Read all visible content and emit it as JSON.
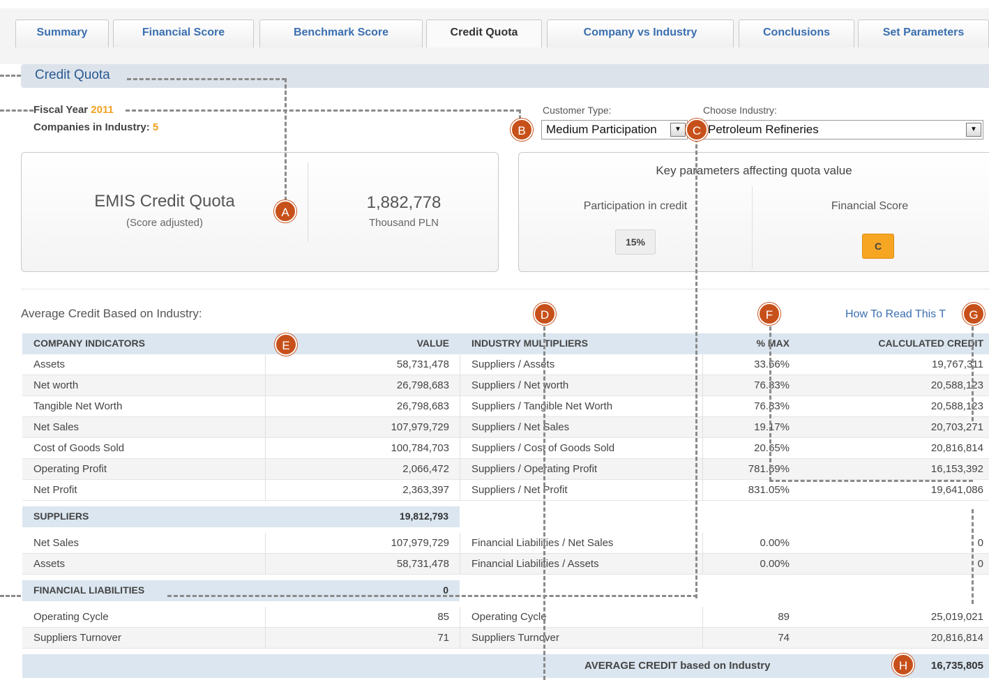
{
  "tabs": [
    {
      "label": "Summary"
    },
    {
      "label": "Financial Score"
    },
    {
      "label": "Benchmark Score"
    },
    {
      "label": "Credit Quota"
    },
    {
      "label": "Company vs Industry"
    },
    {
      "label": "Conclusions"
    },
    {
      "label": "Set Parameters"
    }
  ],
  "active_tab": "Credit Quota",
  "section_title": "Credit Quota",
  "fiscal_year": {
    "label": "Fiscal Year",
    "value": "2011"
  },
  "companies": {
    "label": "Companies in Industry:",
    "value": "5"
  },
  "customer_type": {
    "label": "Customer Type:",
    "value": "Medium Participation"
  },
  "industry": {
    "label": "Choose Industry:",
    "value": "Petroleum Refineries"
  },
  "quota_panel": {
    "title": "EMIS Credit Quota",
    "subtitle": "(Score adjusted)",
    "value": "1,882,778",
    "unit": "Thousand PLN"
  },
  "key_params": {
    "title": "Key parameters affecting quota value",
    "participation_label": "Participation in credit",
    "participation_value": "15%",
    "score_label": "Financial Score",
    "score_value": "C"
  },
  "avg_title": "Average Credit Based on Industry:",
  "how_to_read": "How To Read This T",
  "columns": {
    "company_indicators": "COMPANY INDICATORS",
    "value": "VALUE",
    "industry_multipliers": "INDUSTRY MULTIPLIERS",
    "pct_max": "% MAX",
    "calculated_credit": "CALCULATED CREDIT"
  },
  "supplier_rows": [
    {
      "indicator": "Assets",
      "value": "58,731,478",
      "multiplier": "Suppliers / Assets",
      "pct": "33.66%",
      "credit": "19,767,311"
    },
    {
      "indicator": "Net worth",
      "value": "26,798,683",
      "multiplier": "Suppliers / Net worth",
      "pct": "76.83%",
      "credit": "20,588,123"
    },
    {
      "indicator": "Tangible Net Worth",
      "value": "26,798,683",
      "multiplier": "Suppliers / Tangible Net Worth",
      "pct": "76.83%",
      "credit": "20,588,123"
    },
    {
      "indicator": "Net Sales",
      "value": "107,979,729",
      "multiplier": "Suppliers / Net Sales",
      "pct": "19.17%",
      "credit": "20,703,271"
    },
    {
      "indicator": "Cost of Goods Sold",
      "value": "100,784,703",
      "multiplier": "Suppliers / Cost of Goods Sold",
      "pct": "20.65%",
      "credit": "20,816,814"
    },
    {
      "indicator": "Operating Profit",
      "value": "2,066,472",
      "multiplier": "Suppliers / Operating Profit",
      "pct": "781.69%",
      "credit": "16,153,392"
    },
    {
      "indicator": "Net Profit",
      "value": "2,363,397",
      "multiplier": "Suppliers / Net Profit",
      "pct": "831.05%",
      "credit": "19,641,086"
    }
  ],
  "suppliers_group": {
    "label": "SUPPLIERS",
    "value": "19,812,793"
  },
  "liability_rows": [
    {
      "indicator": "Net Sales",
      "value": "107,979,729",
      "multiplier": "Financial Liabilities / Net Sales",
      "pct": "0.00%",
      "credit": "0"
    },
    {
      "indicator": "Assets",
      "value": "58,731,478",
      "multiplier": "Financial Liabilities / Assets",
      "pct": "0.00%",
      "credit": "0"
    }
  ],
  "liabilities_group": {
    "label": "FINANCIAL LIABILITIES",
    "value": "0"
  },
  "cycle_rows": [
    {
      "indicator": "Operating Cycle",
      "value": "85",
      "multiplier": "Operating Cycle",
      "pct": "89",
      "credit": "25,019,021"
    },
    {
      "indicator": "Suppliers Turnover",
      "value": "71",
      "multiplier": "Suppliers Turnover",
      "pct": "74",
      "credit": "20,816,814"
    }
  ],
  "average": {
    "label": "AVERAGE CREDIT based on Industry",
    "value": "16,735,805"
  },
  "badges": [
    "A",
    "B",
    "C",
    "D",
    "E",
    "F",
    "G",
    "H"
  ]
}
